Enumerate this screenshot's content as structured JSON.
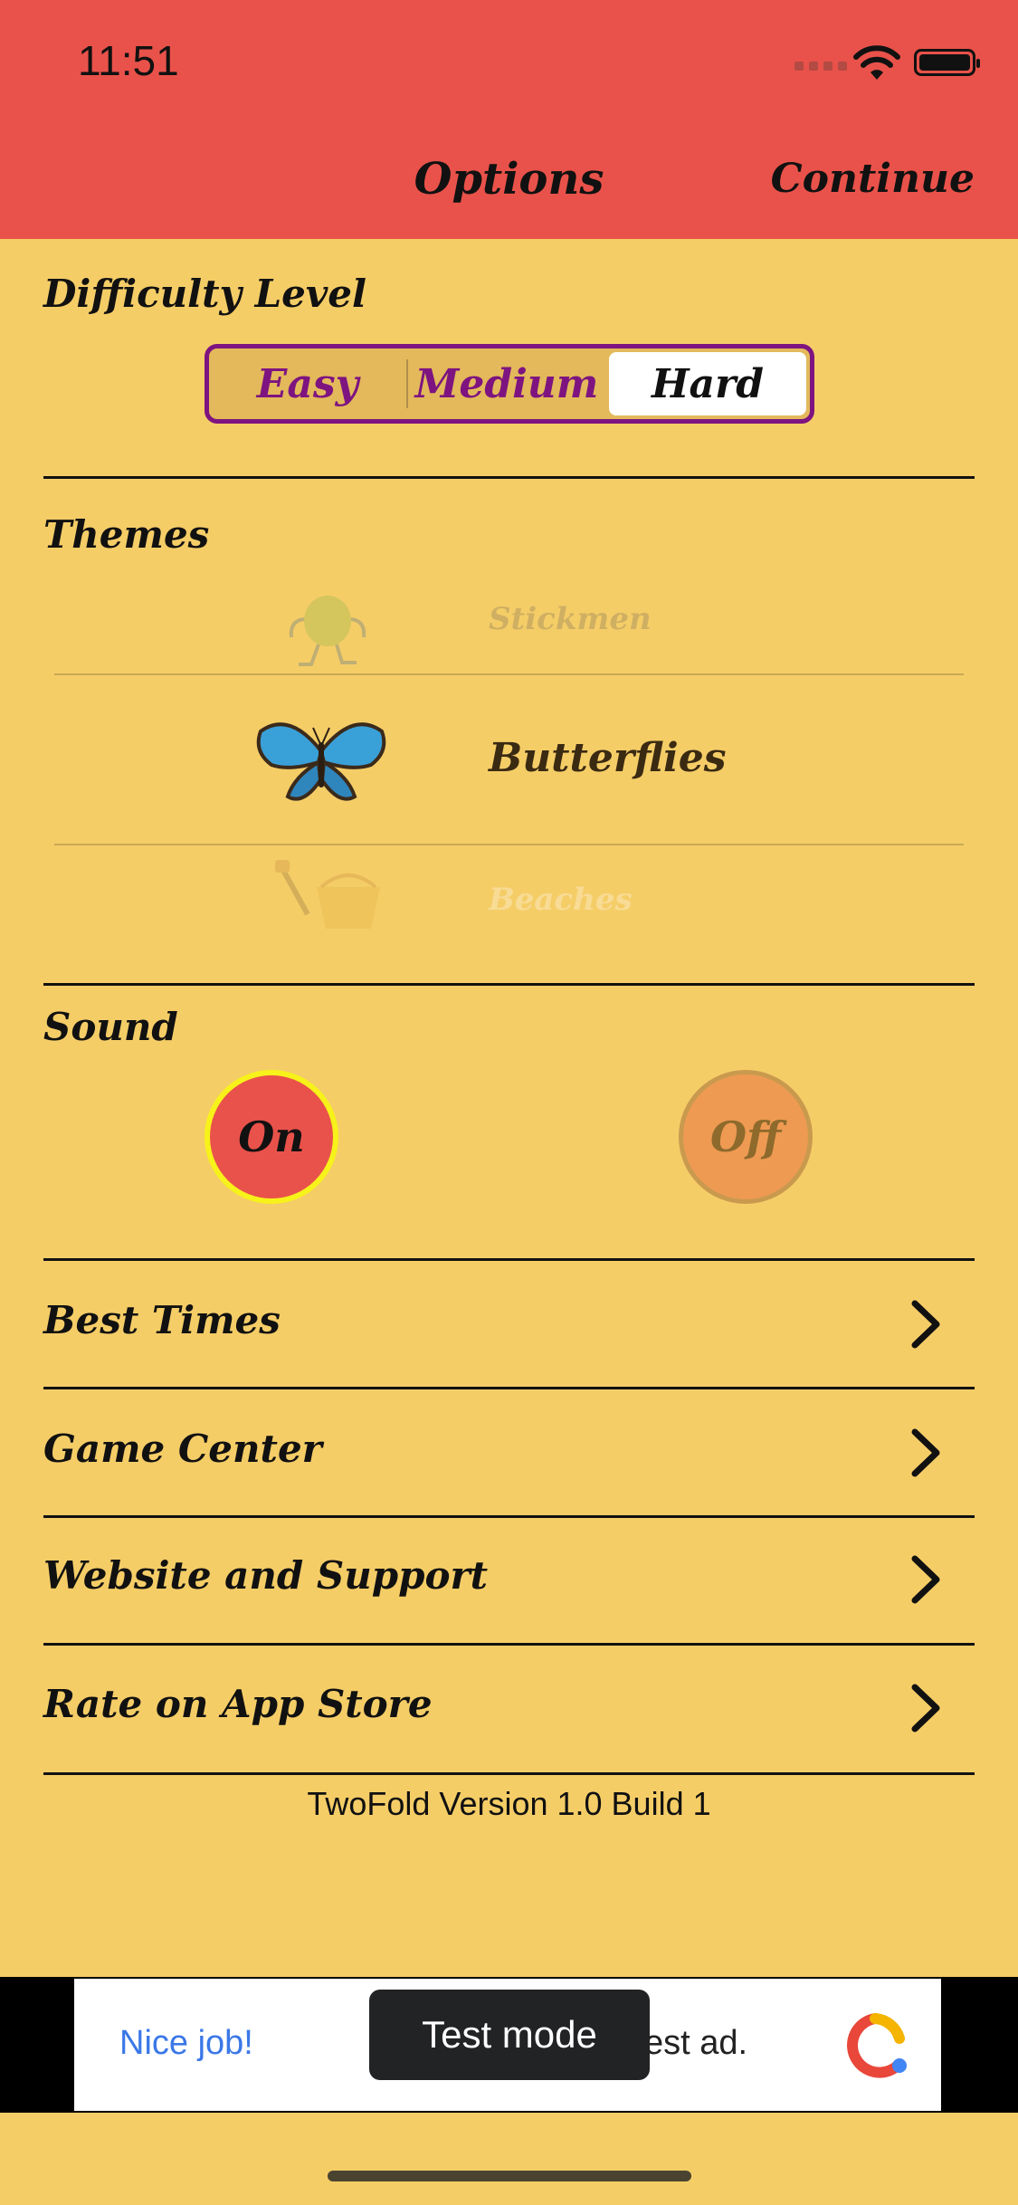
{
  "status": {
    "time": "11:51"
  },
  "header": {
    "title": "Options",
    "continue_label": "Continue"
  },
  "difficulty": {
    "label": "Difficulty Level",
    "options": [
      "Easy",
      "Medium",
      "Hard"
    ],
    "selected": "Hard"
  },
  "themes": {
    "label": "Themes",
    "items": [
      {
        "name": "Stickmen",
        "icon": "stickman-icon"
      },
      {
        "name": "Butterflies",
        "icon": "butterfly-icon"
      },
      {
        "name": "Beaches",
        "icon": "beach-bucket-icon"
      }
    ],
    "selected": "Butterflies"
  },
  "sound": {
    "label": "Sound",
    "on_label": "On",
    "off_label": "Off",
    "selected": "On"
  },
  "menu": [
    {
      "label": "Best Times"
    },
    {
      "label": "Game Center"
    },
    {
      "label": "Website and Support"
    },
    {
      "label": "Rate on App Store"
    }
  ],
  "version": "TwoFold Version 1.0 Build 1",
  "ad": {
    "text_left": "Nice job!",
    "text_right": "est ad.",
    "toast": "Test mode"
  },
  "colors": {
    "header": "#e9524a",
    "background": "#f5cd67",
    "accent": "#7e1480"
  }
}
